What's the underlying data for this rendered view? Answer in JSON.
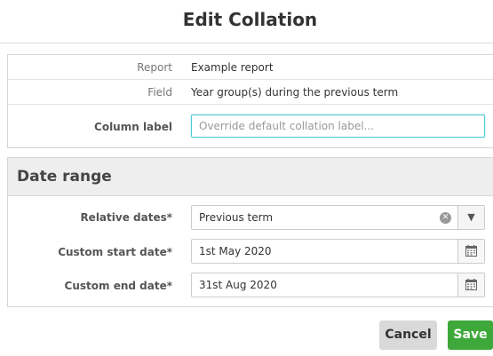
{
  "dialog": {
    "title": "Edit Collation"
  },
  "fields": {
    "report_label": "Report",
    "report_value": "Example report",
    "field_label": "Field",
    "field_value": "Year group(s) during the previous term",
    "column_label": "Column label",
    "column_placeholder": "Override default collation label...",
    "column_value": ""
  },
  "date_range": {
    "title": "Date range",
    "relative_label": "Relative dates*",
    "relative_value": "Previous term",
    "start_label": "Custom start date*",
    "start_value": "1st May 2020",
    "end_label": "Custom end date*",
    "end_value": "31st Aug 2020"
  },
  "actions": {
    "cancel": "Cancel",
    "save": "Save"
  },
  "icons": {
    "clear": "clear-icon",
    "dropdown": "chevron-down-icon",
    "calendar": "calendar-icon"
  },
  "colors": {
    "accent": "#4ec9d6",
    "save": "#3ea83a",
    "cancel": "#d9d9d9"
  }
}
